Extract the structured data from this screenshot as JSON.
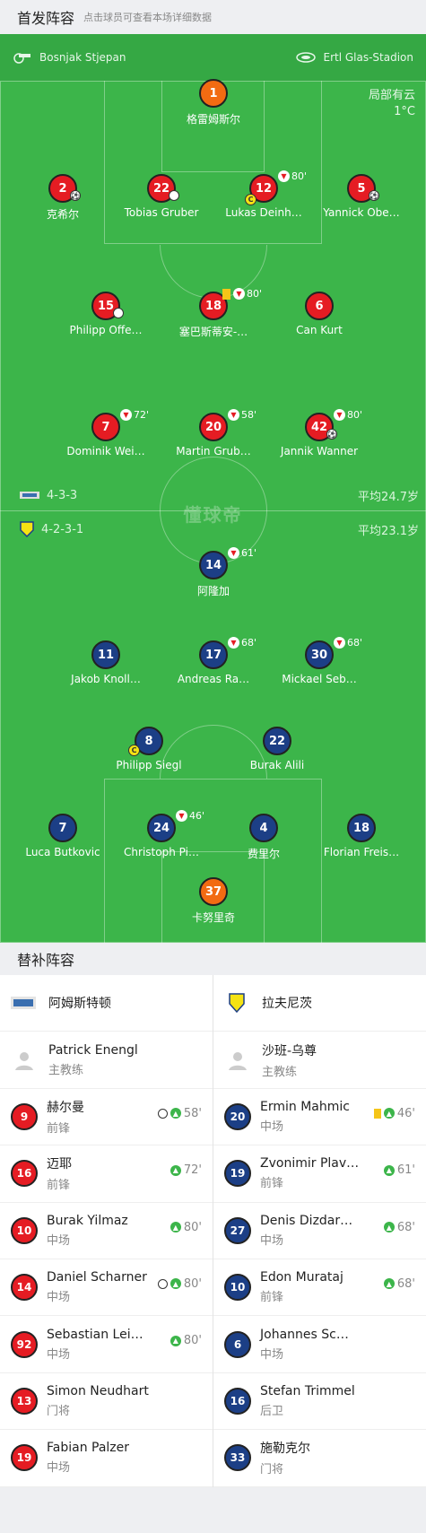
{
  "header": {
    "title": "首发阵容",
    "hint": "点击球员可查看本场详细数据"
  },
  "referee": "Bosnjak Stjepan",
  "stadium": "Ertl Glas-Stadion",
  "weather": {
    "condition": "局部有云",
    "temp": "1°C"
  },
  "watermark": "懂球帝",
  "home": {
    "formation": "4-3-3",
    "avg_age": "平均24.7岁",
    "players": [
      {
        "num": "1",
        "name": "格雷姆斯尔"
      },
      {
        "num": "2",
        "name": "克希尔"
      },
      {
        "num": "22",
        "name": "Tobias Gruber"
      },
      {
        "num": "12",
        "name": "Lukas Deinh…",
        "sub": "80'"
      },
      {
        "num": "5",
        "name": "Yannick Obe…"
      },
      {
        "num": "15",
        "name": "Philipp Offe…"
      },
      {
        "num": "18",
        "name": "塞巴斯蒂安-…",
        "sub": "80'"
      },
      {
        "num": "6",
        "name": "Can Kurt"
      },
      {
        "num": "7",
        "name": "Dominik Wei…",
        "sub": "72'"
      },
      {
        "num": "20",
        "name": "Martin Grub…",
        "sub": "58'"
      },
      {
        "num": "42",
        "name": "Jannik Wanner",
        "sub": "80'"
      }
    ]
  },
  "away": {
    "formation": "4-2-3-1",
    "avg_age": "平均23.1岁",
    "players": [
      {
        "num": "14",
        "name": "阿隆加",
        "sub": "61'"
      },
      {
        "num": "11",
        "name": "Jakob Knoll…"
      },
      {
        "num": "17",
        "name": "Andreas Ra…",
        "sub": "68'"
      },
      {
        "num": "30",
        "name": "Mickael Seb…",
        "sub": "68'"
      },
      {
        "num": "8",
        "name": "Philipp Siegl"
      },
      {
        "num": "22",
        "name": "Burak Alili"
      },
      {
        "num": "7",
        "name": "Luca Butkovic"
      },
      {
        "num": "24",
        "name": "Christoph Pi…",
        "sub": "46'"
      },
      {
        "num": "4",
        "name": "费里尔"
      },
      {
        "num": "18",
        "name": "Florian Freis…"
      },
      {
        "num": "37",
        "name": "卡努里奇"
      }
    ]
  },
  "subs_header": "替补阵容",
  "subs": {
    "home_team": "阿姆斯特顿",
    "away_team": "拉夫尼茨",
    "home_coach": {
      "name": "Patrick Enengl",
      "role": "主教练"
    },
    "away_coach": {
      "name": "沙班-乌尊",
      "role": "主教练"
    },
    "home": [
      {
        "num": "9",
        "name": "赫尔曼",
        "pos": "前锋",
        "time": "58'",
        "goal": true
      },
      {
        "num": "16",
        "name": "迈耶",
        "pos": "前锋",
        "time": "72'"
      },
      {
        "num": "10",
        "name": "Burak Yilmaz",
        "pos": "中场",
        "time": "80'"
      },
      {
        "num": "14",
        "name": "Daniel Scharner",
        "pos": "中场",
        "time": "80'",
        "goal": true
      },
      {
        "num": "92",
        "name": "Sebastian Lei…",
        "pos": "中场",
        "time": "80'"
      },
      {
        "num": "13",
        "name": "Simon Neudhart",
        "pos": "门将"
      },
      {
        "num": "19",
        "name": "Fabian Palzer",
        "pos": "中场"
      }
    ],
    "away": [
      {
        "num": "20",
        "name": "Ermin Mahmic",
        "pos": "中场",
        "time": "46'",
        "card": true
      },
      {
        "num": "19",
        "name": "Zvonimir Plav…",
        "pos": "前锋",
        "time": "61'"
      },
      {
        "num": "27",
        "name": "Denis Dizdar…",
        "pos": "中场",
        "time": "68'"
      },
      {
        "num": "10",
        "name": "Edon Murataj",
        "pos": "前锋",
        "time": "68'"
      },
      {
        "num": "6",
        "name": "Johannes Sc…",
        "pos": "中场"
      },
      {
        "num": "16",
        "name": "Stefan Trimmel",
        "pos": "后卫"
      },
      {
        "num": "33",
        "name": "施勒克尔",
        "pos": "门将"
      }
    ]
  }
}
